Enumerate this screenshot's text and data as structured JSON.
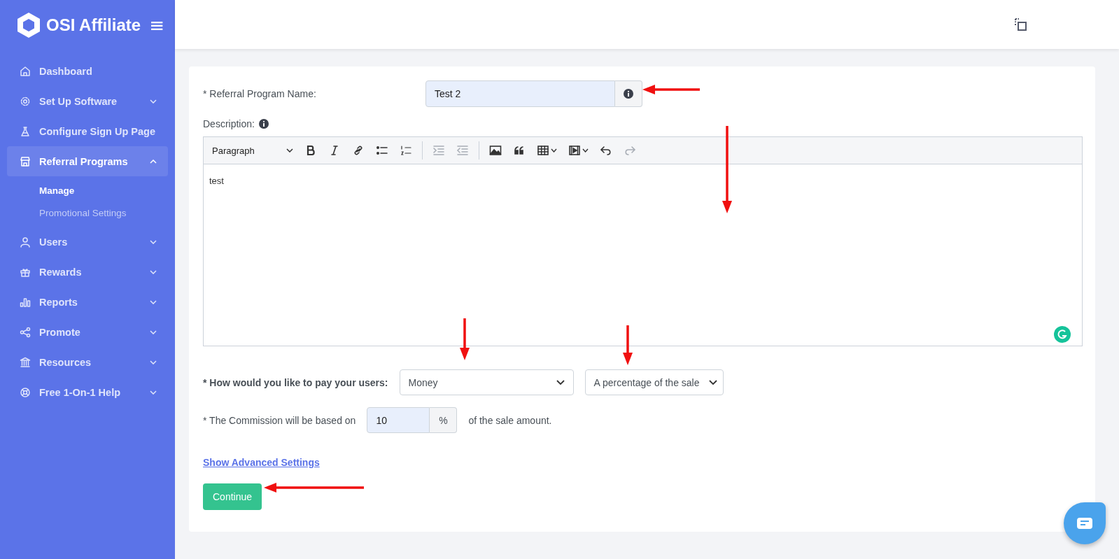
{
  "brand": {
    "name": "OSI Affiliate",
    "menu_glyph": "≡"
  },
  "sidebar": {
    "items": [
      {
        "label": "Dashboard",
        "kind": "home",
        "selected": false
      },
      {
        "label": "Set Up Software",
        "kind": "gear",
        "selected": false,
        "expanded": false
      },
      {
        "label": "Configure Sign Up Page",
        "kind": "flask",
        "selected": false
      },
      {
        "label": "Referral Programs",
        "kind": "store",
        "selected": true,
        "expanded": true,
        "children": [
          {
            "label": "Manage",
            "selected": true
          },
          {
            "label": "Promotional Settings",
            "selected": false
          }
        ]
      },
      {
        "label": "Users",
        "kind": "user",
        "selected": false,
        "expanded": false
      },
      {
        "label": "Rewards",
        "kind": "gift",
        "selected": false,
        "expanded": false
      },
      {
        "label": "Reports",
        "kind": "bars",
        "selected": false,
        "expanded": false
      },
      {
        "label": "Promote",
        "kind": "share",
        "selected": false,
        "expanded": false
      },
      {
        "label": "Resources",
        "kind": "bank",
        "selected": false,
        "expanded": false
      },
      {
        "label": "Free 1-On-1 Help",
        "kind": "lifebuoy",
        "selected": false,
        "expanded": false
      }
    ]
  },
  "form": {
    "name_label": "* Referral Program Name:",
    "name_value": "Test 2",
    "description_label": "Description:",
    "editor": {
      "block_format": "Paragraph",
      "tools": [
        {
          "kind": "bold",
          "disabled": false
        },
        {
          "kind": "italic",
          "disabled": false
        },
        {
          "kind": "link",
          "disabled": false
        },
        {
          "kind": "bullets",
          "disabled": false
        },
        {
          "kind": "numbers",
          "disabled": false
        },
        {
          "kind": "indent",
          "disabled": true
        },
        {
          "kind": "outdent",
          "disabled": true
        },
        {
          "kind": "image",
          "disabled": false
        },
        {
          "kind": "quote",
          "disabled": false
        },
        {
          "kind": "table",
          "disabled": false
        },
        {
          "kind": "media",
          "disabled": false
        },
        {
          "kind": "undo",
          "disabled": false
        },
        {
          "kind": "redo",
          "disabled": true
        }
      ],
      "content": "test"
    },
    "pay_label": "* How would you like to pay your users:",
    "pay_method": "Money",
    "pay_type": "A percentage of the sale",
    "commission_label": "* The Commission will be based on",
    "commission_value": "10",
    "commission_unit": "%",
    "commission_suffix": "of the sale amount.",
    "advanced_link": "Show Advanced Settings",
    "continue_button": "Continue"
  },
  "annotation_arrows": [
    {
      "kind": "left"
    },
    {
      "kind": "down"
    },
    {
      "kind": "down"
    },
    {
      "kind": "down"
    },
    {
      "kind": "left"
    }
  ]
}
